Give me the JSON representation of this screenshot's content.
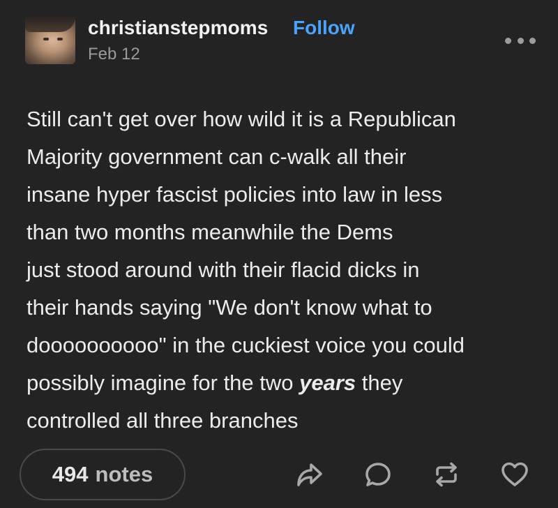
{
  "post": {
    "author": "christianstepmoms",
    "follow_label": "Follow",
    "date": "Feb 12",
    "lines": [
      "Still can't get over how wild it is a Republican",
      "Majority government can c-walk all their",
      "insane hyper fascist policies into law in less",
      "than two months meanwhile the Dems",
      "just stood around with their flacid dicks in",
      "their hands saying \"We don't know what to",
      "doooooooooo\" in the cuckiest voice you could"
    ],
    "line8_before": "possibly imagine for the two ",
    "line8_emphasis": "years",
    "line8_after": " they",
    "line9": "controlled all three branches"
  },
  "footer": {
    "notes_count": "494",
    "notes_label": "notes"
  },
  "icons": {
    "more": "more-options-icon",
    "share": "share-icon",
    "reply": "reply-icon",
    "reblog": "reblog-icon",
    "like": "heart-icon"
  },
  "colors": {
    "background": "#232323",
    "accent": "#4aa3ff",
    "text": "#ececec",
    "muted": "#9a9a9a"
  }
}
